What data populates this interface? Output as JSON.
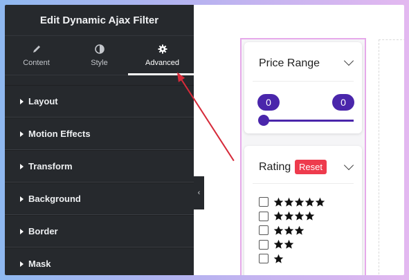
{
  "panel": {
    "title": "Edit Dynamic Ajax Filter",
    "tabs": [
      {
        "label": "Content",
        "icon": "pencil-icon"
      },
      {
        "label": "Style",
        "icon": "contrast-icon"
      },
      {
        "label": "Advanced",
        "icon": "gear-icon",
        "active": true
      }
    ],
    "sections": [
      "Layout",
      "Motion Effects",
      "Transform",
      "Background",
      "Border",
      "Mask"
    ]
  },
  "preview": {
    "price_range": {
      "title": "Price Range",
      "min_value": "0",
      "max_value": "0"
    },
    "rating": {
      "title": "Rating",
      "reset_label": "Reset",
      "options": [
        5,
        4,
        3,
        2,
        1
      ]
    }
  },
  "colors": {
    "panel_bg": "#26292d",
    "accent": "#4a26ab",
    "reset": "#ee3b4d",
    "widget_border": "#e6a9ea",
    "annotation_arrow": "#d62b3a"
  }
}
